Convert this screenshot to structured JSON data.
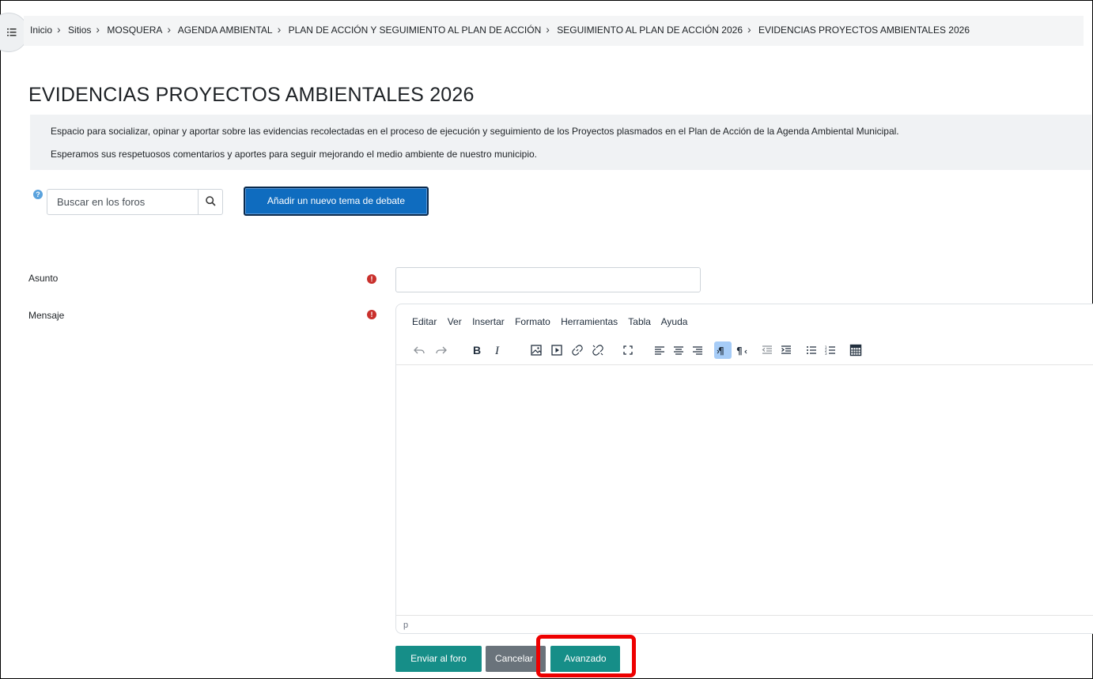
{
  "breadcrumb": [
    "Inicio",
    "Sitios",
    "MOSQUERA",
    "AGENDA AMBIENTAL",
    "PLAN DE ACCIÓN Y SEGUIMIENTO AL PLAN DE ACCIÓN",
    "SEGUIMIENTO AL PLAN DE ACCIÓN 2026",
    "EVIDENCIAS PROYECTOS AMBIENTALES 2026"
  ],
  "page": {
    "title": "EVIDENCIAS PROYECTOS AMBIENTALES 2026",
    "intro_line1": "Espacio para socializar, opinar y aportar sobre las evidencias recolectadas en el proceso de ejecución y seguimiento de los Proyectos plasmados en el Plan de Acción de la Agenda Ambiental Municipal.",
    "intro_line2": "Esperamos sus respetuosos comentarios y aportes para seguir mejorando el medio ambiente de nuestro municipio."
  },
  "search": {
    "placeholder": "Buscar en los foros",
    "help_glyph": "?"
  },
  "add_topic_label": "Añadir un nuevo tema de debate",
  "form": {
    "subject_label": "Asunto",
    "message_label": "Mensaje",
    "subject_value": "",
    "required_glyph": "!"
  },
  "editor": {
    "menu": [
      "Editar",
      "Ver",
      "Insertar",
      "Formato",
      "Herramientas",
      "Tabla",
      "Ayuda"
    ],
    "status_path": "p"
  },
  "buttons": {
    "submit": "Enviar al foro",
    "cancel": "Cancelar",
    "advanced": "Avanzado"
  },
  "colors": {
    "primary": "#0f6cbf",
    "success": "#168e88",
    "secondary": "#6a737b",
    "required": "#c9302c",
    "highlight": "#ee0000"
  }
}
